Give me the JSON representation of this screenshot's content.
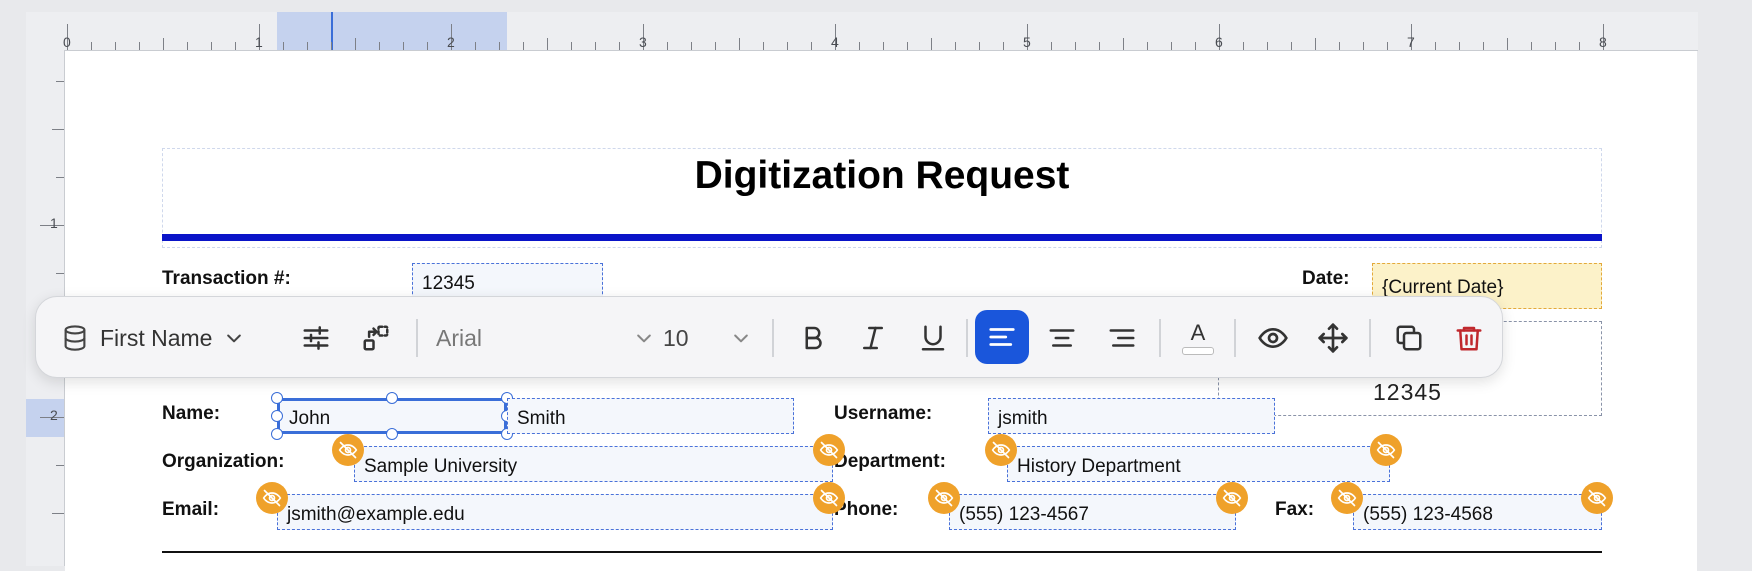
{
  "ruler": {
    "horizontal_numbers": [
      "0",
      "1",
      "2",
      "3",
      "4",
      "5",
      "6",
      "7",
      "8"
    ],
    "vertical_numbers": [
      "1",
      "2"
    ]
  },
  "document": {
    "title": "Digitization Request",
    "fields": {
      "transaction_label": "Transaction #:",
      "transaction_value": "12345",
      "date_label": "Date:",
      "date_value": "{Current Date}",
      "box_value": "12345",
      "name_label": "Name:",
      "first_name": "John",
      "last_name": "Smith",
      "username_label": "Username:",
      "username_value": "jsmith",
      "organization_label": "Organization:",
      "organization_value": "Sample University",
      "department_label": "Department:",
      "department_value": "History Department",
      "email_label": "Email:",
      "email_value": "jsmith@example.edu",
      "phone_label": "Phone:",
      "phone_value": "(555) 123-4567",
      "fax_label": "Fax:",
      "fax_value": "(555) 123-4568"
    }
  },
  "toolbar": {
    "field_name": "First Name",
    "font_family": "Arial",
    "font_size": "10",
    "text_color_glyph": "A",
    "icons": [
      "database-icon",
      "sliders-icon",
      "convert-icon",
      "bold-icon",
      "italic-icon",
      "underline-icon",
      "align-left-icon",
      "align-center-icon",
      "align-right-icon",
      "text-color-icon",
      "eye-icon",
      "move-icon",
      "duplicate-icon",
      "trash-icon"
    ]
  },
  "colors": {
    "accent": "#1a56db",
    "title_rule": "#0a14c8",
    "hidden_badge": "#efa12a",
    "delete": "#c0282d",
    "date_highlight": "#fcf2c9"
  }
}
